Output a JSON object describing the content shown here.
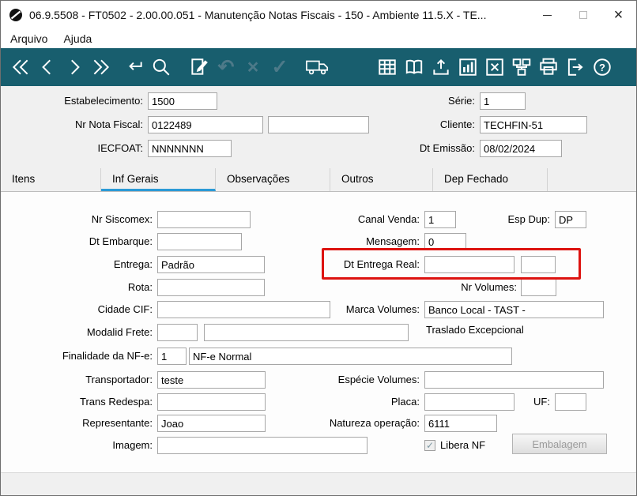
{
  "window": {
    "title": "06.9.5508 - FT0502 - 2.00.00.051 - Manutenção Notas Fiscais - 150 - Ambiente 11.5.X - TE...",
    "controls": {
      "close": "×"
    }
  },
  "menu": {
    "items": [
      {
        "label": "Arquivo"
      },
      {
        "label": "Ajuda"
      }
    ]
  },
  "toolbar": {
    "icons": [
      "first-record",
      "previous-record",
      "next-record",
      "last-record",
      "enter",
      "search",
      "edit-document",
      "undo",
      "delete",
      "confirm",
      "delivery-truck",
      "table-view",
      "reference-guide",
      "upload",
      "chart",
      "close-table",
      "related-tables",
      "print",
      "exit",
      "help"
    ],
    "glyphs": {
      "undo": "↶",
      "delete": "×",
      "confirm": "✓"
    }
  },
  "colors": {
    "toolbar_bg": "#185e6e",
    "tab_accent": "#2b9ad6",
    "highlight_red": "#dd1310",
    "icon_muted": "#4d7a89"
  },
  "header": {
    "estabelecimento": {
      "label": "Estabelecimento:",
      "value": "1500"
    },
    "serie": {
      "label": "Série:",
      "value": "1"
    },
    "nr_nota_fiscal": {
      "label": "Nr Nota Fiscal:",
      "value": "0122489",
      "value2": ""
    },
    "cliente": {
      "label": "Cliente:",
      "value": "TECHFIN-51"
    },
    "iecfoat": {
      "label": "IECFOAT:",
      "value": "NNNNNNN"
    },
    "dt_emissao": {
      "label": "Dt Emissão:",
      "value": "08/02/2024"
    }
  },
  "tabs": {
    "items": [
      {
        "label": "Itens",
        "selected": false
      },
      {
        "label": "Inf Gerais",
        "selected": true
      },
      {
        "label": "Observações",
        "selected": false
      },
      {
        "label": "Outros",
        "selected": false
      },
      {
        "label": "Dep Fechado",
        "selected": false
      }
    ]
  },
  "form": {
    "nr_siscomex": {
      "label": "Nr Siscomex:",
      "value": ""
    },
    "canal_venda": {
      "label": "Canal Venda:",
      "value": "1"
    },
    "esp_dup": {
      "label": "Esp Dup:",
      "value": "DP"
    },
    "dt_embarque": {
      "label": "Dt Embarque:",
      "value": ""
    },
    "mensagem": {
      "label": "Mensagem:",
      "value": "0"
    },
    "entrega": {
      "label": "Entrega:",
      "value": "Padrão"
    },
    "dt_entrega_real": {
      "label": "Dt Entrega Real:",
      "value": "",
      "value2": ""
    },
    "rota": {
      "label": "Rota:",
      "value": ""
    },
    "nr_volumes": {
      "label": "Nr Volumes:",
      "value": ""
    },
    "cidade_cif": {
      "label": "Cidade CIF:",
      "value": ""
    },
    "marca_volumes": {
      "label": "Marca Volumes:",
      "value": "Banco Local - TAST -"
    },
    "modalid_frete": {
      "label": "Modalid Frete:",
      "value": "",
      "value2": ""
    },
    "traslado": {
      "text": "Traslado Excepcional"
    },
    "finalidade_nfe": {
      "label": "Finalidade da NF-e:",
      "value": "1",
      "value2": "NF-e Normal"
    },
    "transportador": {
      "label": "Transportador:",
      "value": "teste"
    },
    "especie_volumes": {
      "label": "Espécie Volumes:",
      "value": ""
    },
    "trans_redespa": {
      "label": "Trans Redespa:",
      "value": ""
    },
    "placa": {
      "label": "Placa:",
      "value": ""
    },
    "uf": {
      "label": "UF:",
      "value": ""
    },
    "representante": {
      "label": "Representante:",
      "value": "Joao"
    },
    "natureza_operacao": {
      "label": "Natureza operação:",
      "value": "6111"
    },
    "imagem": {
      "label": "Imagem:",
      "value": ""
    },
    "libera_nf": {
      "label": "Libera NF",
      "checked": true,
      "check_glyph": "✓"
    },
    "embalagem_button": {
      "label": "Embalagem"
    }
  }
}
